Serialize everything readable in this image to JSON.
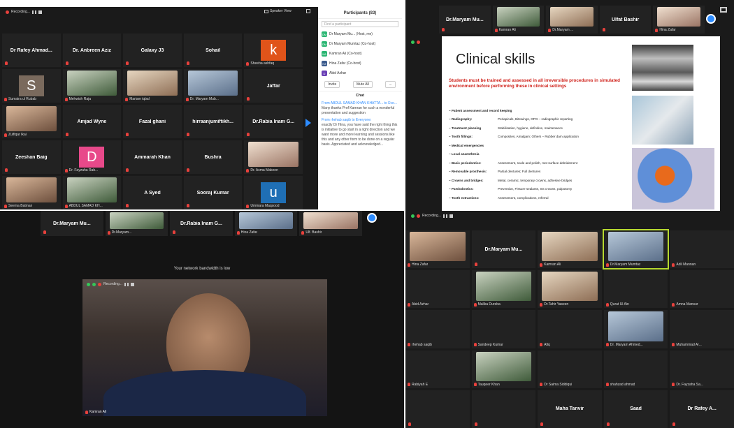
{
  "q1": {
    "rec_label": "Recording...",
    "speaker_view": "Speaker View",
    "tiles": [
      {
        "name": "Dr Rafey Ahmad...",
        "caption": ""
      },
      {
        "name": "Dr. Anbreen Aziz",
        "caption": ""
      },
      {
        "name": "Galaxy J3",
        "caption": ""
      },
      {
        "name": "Sohail",
        "caption": ""
      },
      {
        "letter": "k",
        "letter_bg": "#e0541a",
        "caption": "Sheeba ashfaq"
      },
      {
        "letter": "S",
        "letter_bg": "#7a6a5d",
        "caption": "Sumaira ul Rubab"
      },
      {
        "photo": true,
        "caption": "Mehwish Raja"
      },
      {
        "photo": true,
        "caption": "Mariam iqbal"
      },
      {
        "photo": true,
        "caption": "Dr. Maryam Mub..."
      },
      {
        "name": "Jaffar",
        "caption": ""
      },
      {
        "photo": true,
        "caption": "Zulfiqar Ikai"
      },
      {
        "name": "Amjad Wyne",
        "caption": ""
      },
      {
        "name": "Fazal ghani",
        "caption": ""
      },
      {
        "name": "hirraanjumiftikh...",
        "caption": ""
      },
      {
        "name": "Dr.Rabia Inam G...",
        "caption": ""
      },
      {
        "name": "Zeeshan Baig",
        "caption": ""
      },
      {
        "letter": "D",
        "letter_bg": "#e8498a",
        "caption": "Dr. Fayzaha Rab..."
      },
      {
        "name": "Ammarah Khan",
        "caption": ""
      },
      {
        "name": "Bushra",
        "caption": ""
      },
      {
        "photo": true,
        "caption": "Dr. Asma Makeen"
      },
      {
        "photo": true,
        "caption": "Seema Batman"
      },
      {
        "photo": true,
        "caption": "ABDUL SAMAD KH..."
      },
      {
        "name": "A Syed",
        "caption": ""
      },
      {
        "name": "Sooraj Kumar",
        "caption": ""
      },
      {
        "letter": "u",
        "letter_bg": "#1f6fb5",
        "caption": "Ummara Maqsood"
      }
    ],
    "participants": {
      "title": "Participants (83)",
      "find_placeholder": "Find a participant",
      "list": [
        {
          "initials": "DM",
          "bg": "#2bb673",
          "name": "Dr Maryam Mu... (Host, me)"
        },
        {
          "initials": "DM",
          "bg": "#2bb673",
          "name": "Dr Maryam Mumtaz (Co-host)"
        },
        {
          "initials": "KA",
          "bg": "#2bb673",
          "name": "Kamran Ali (Co-host)"
        },
        {
          "initials": "HZ",
          "bg": "#3a5a8c",
          "name": "Hina Zafar (Co-host)"
        },
        {
          "initials": "D",
          "bg": "#6a3fb5",
          "name": "Abid Azhar"
        }
      ],
      "btn_invite": "Invite",
      "btn_mute_all": "Mute All",
      "btn_more": "...",
      "chat_title": "Chat",
      "chat": [
        {
          "from": "From ABDUL SAMAD KHAN KHATTA... to Eve...",
          "text": "Many thanks Prof Kamran for such a wonderful presentation and suggestion"
        },
        {
          "from": "From rhehab saqib to Everyone:",
          "text": "exactly Dr Hina, you have said the right thing this is initiative to go start in a right direction and we want more and more learning and sessions like this and any other form to be done on a regular basis. Appreciated and acknowledged..."
        }
      ]
    }
  },
  "q2": {
    "top_strip": [
      {
        "name": "Dr.Maryam Mu...",
        "caption": ""
      },
      {
        "photo": true,
        "caption": "Kamran Ali"
      },
      {
        "photo": true,
        "caption": "Dr.Maryam ..."
      },
      {
        "name": "Ulfat Bashir",
        "caption": ""
      },
      {
        "photo": true,
        "caption": "Hina Zafar"
      }
    ],
    "slide": {
      "title": "Clinical skills",
      "intro": "Students must be trained and assessed in all irreversible procedures in simulated environment before performing these in clinical settings",
      "items": [
        {
          "k": "Patient assessment and record keeping",
          "v": ""
        },
        {
          "k": "Radiography:",
          "v": "Periapicals, Bitewings, OPG – radiographic reporting"
        },
        {
          "k": "Treatment planning",
          "v": "Stabilisation, hygiene, definitive, maintenance"
        },
        {
          "k": "Tooth fillings:",
          "v": "Composites, Amalgam; Others – Rubber dam application"
        },
        {
          "k": "Medical emergencies",
          "v": ""
        },
        {
          "k": "Local anaesthesia",
          "v": ""
        },
        {
          "k": "Basic periodontics:",
          "v": "Assessment, scale and polish, root surface debridement"
        },
        {
          "k": "Removable prosthesis:",
          "v": "Partial dentures; Full dentures"
        },
        {
          "k": "Crowns and bridges:",
          "v": "Metal, ceramic, temporary crowns, adhesive bridges"
        },
        {
          "k": "Paedodontics:",
          "v": "Prevention, Fissure sealants, SS crowns, pulpotomy"
        },
        {
          "k": "Tooth extractions:",
          "v": "Assessment, complications, referral"
        }
      ]
    }
  },
  "q3": {
    "top_strip": [
      {
        "name": "Dr.Maryam Mu...",
        "caption": ""
      },
      {
        "photo": true,
        "caption": "Dr.Maryam..."
      },
      {
        "name": "Dr.Rabia Inam G...",
        "caption": ""
      },
      {
        "photo": true,
        "caption": "Hina Zafar"
      },
      {
        "photo": true,
        "caption": "Ulf. Bashir"
      }
    ],
    "bandwidth_msg": "Your network bandwidth is low",
    "speaker_caption": "Kamran Ali",
    "rec_label": "Recording..."
  },
  "q4": {
    "rec_label": "Recording...",
    "tiles": [
      {
        "photo": true,
        "caption": "Hina Zafar"
      },
      {
        "name": "Dr.Maryam Mu...",
        "caption": ""
      },
      {
        "photo": true,
        "caption": "Kamran Ali"
      },
      {
        "photo": true,
        "caption": "Dr.Maryam Mumtaz",
        "active": true
      },
      {
        "name": "",
        "caption": "Adil Mannan"
      },
      {
        "name": "",
        "caption": "Abid Azhar"
      },
      {
        "photo": true,
        "caption": "Malika Dureba"
      },
      {
        "photo": true,
        "caption": "Dr.Tahir Yaseen"
      },
      {
        "name": "",
        "caption": "Qurat Ul Ain"
      },
      {
        "name": "",
        "caption": "Amna Mansur"
      },
      {
        "name": "",
        "caption": "rhehab saqib"
      },
      {
        "name": "",
        "caption": "Sandeep Kumar"
      },
      {
        "name": "",
        "caption": "Afiq"
      },
      {
        "photo": true,
        "caption": "Dr. Maryam Ahmed..."
      },
      {
        "name": "",
        "caption": "Muhammad Ar..."
      },
      {
        "name": "",
        "caption": "Rabiyah E"
      },
      {
        "photo": true,
        "caption": "Tauqeer Khan"
      },
      {
        "name": "",
        "caption": "Dr Saima Siddiqui"
      },
      {
        "name": "",
        "caption": "shahzad ahmad"
      },
      {
        "name": "",
        "caption": "Dr. Fayzaha Sa..."
      },
      {
        "name": "",
        "caption": ""
      },
      {
        "name": "",
        "caption": ""
      },
      {
        "name": "Maha Tanvir",
        "caption": ""
      },
      {
        "name": "Saad",
        "caption": ""
      },
      {
        "name": "Dr Rafey A...",
        "caption": ""
      }
    ]
  },
  "colors": {
    "panel_bg": "#1a1a1a",
    "tile_bg": "#222222",
    "mic_muted": "#e8413c",
    "zoom_blue": "#2d8cff",
    "active_speaker": "#b7d92f"
  }
}
